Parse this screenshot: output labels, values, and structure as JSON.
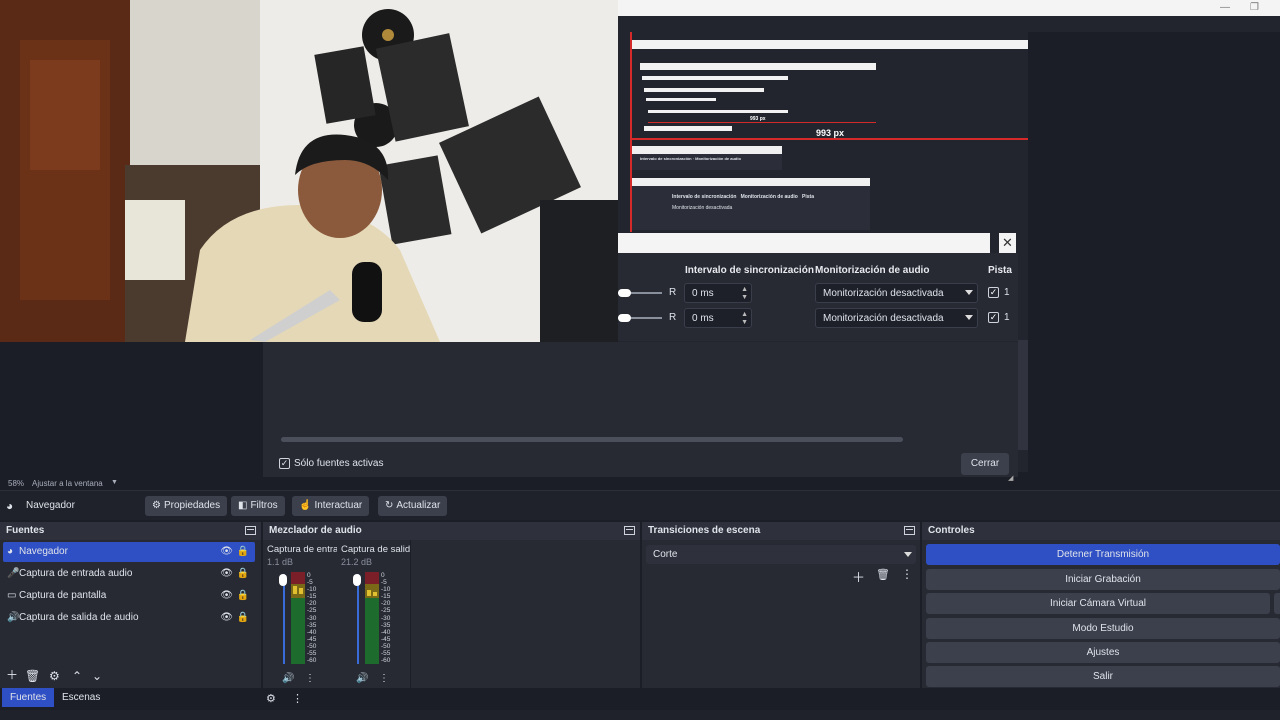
{
  "preview": {
    "recursion_label": "993 px",
    "mini_label": "993 px",
    "audio_dialog": {
      "col_sync": "Intervalo de sincronización",
      "col_monitor": "Monitorización de audio",
      "col_tracks": "Pista",
      "rows": [
        {
          "balance": "R",
          "sync": "0 ms",
          "monitor": "Monitorización desactivada",
          "track": "1"
        },
        {
          "balance": "R",
          "sync": "0 ms",
          "monitor": "Monitorización desactivada",
          "track": "1"
        }
      ],
      "only_active": "Sólo fuentes activas",
      "close": "Cerrar"
    }
  },
  "zoom": {
    "percent": "58%",
    "label": "Ajustar a la ventana"
  },
  "toolbar": {
    "source_name": "Navegador",
    "properties": "Propiedades",
    "filters": "Filtros",
    "interact": "Interactuar",
    "refresh": "Actualizar"
  },
  "sources": {
    "title": "Fuentes",
    "items": [
      {
        "label": "Navegador",
        "icon": "globe-icon",
        "selected": true
      },
      {
        "label": "Captura de entrada audio",
        "icon": "microphone-icon",
        "selected": false
      },
      {
        "label": "Captura de pantalla",
        "icon": "monitor-icon",
        "selected": false
      },
      {
        "label": "Captura de salida de audio",
        "icon": "speaker-icon",
        "selected": false
      }
    ],
    "tab_sources": "Fuentes",
    "tab_scenes": "Escenas"
  },
  "mixer": {
    "title": "Mezclador de audio",
    "channels": [
      {
        "name": "Captura de entra",
        "db": "1.1 dB"
      },
      {
        "name": "Captura de salid",
        "db": "21.2 dB"
      }
    ],
    "scale": [
      "0",
      "-5",
      "-10",
      "-15",
      "-20",
      "-25",
      "-30",
      "-35",
      "-40",
      "-45",
      "-50",
      "-55",
      "-60"
    ]
  },
  "transitions": {
    "title": "Transiciones de escena",
    "selected": "Corte"
  },
  "controls": {
    "title": "Controles",
    "stop_stream": "Detener Transmisión",
    "start_recording": "Iniciar Grabación",
    "virtual_camera": "Iniciar Cámara Virtual",
    "studio_mode": "Modo Estudio",
    "settings": "Ajustes",
    "exit": "Salir"
  },
  "colors": {
    "accent": "#2f50c4",
    "bg": "#1b1e26",
    "panel": "#272a33",
    "button": "#3c404c"
  }
}
